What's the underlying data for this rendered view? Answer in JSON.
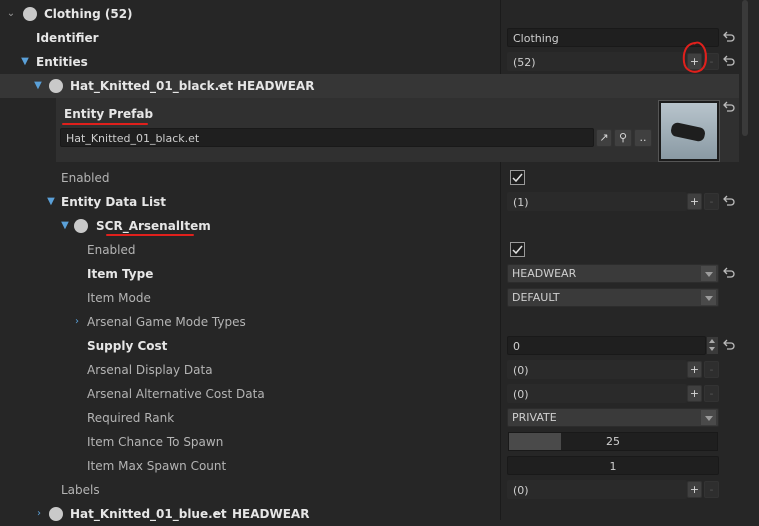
{
  "colors": {
    "accent_arrow": "#5aa0d8",
    "annotation": "#e0201c",
    "background": "#262626"
  },
  "header": {
    "title": "Clothing (52)"
  },
  "identifier": {
    "label": "Identifier",
    "value": "Clothing"
  },
  "entities": {
    "label": "Entities",
    "value": "(52)",
    "add": "+",
    "remove": "-"
  },
  "entity1": {
    "name": "Hat_Knitted_01_black.et",
    "sep": "~",
    "tag": "HEADWEAR"
  },
  "prefab": {
    "label": "Entity Prefab",
    "path": "Hat_Knitted_01_black.et",
    "browse": ".."
  },
  "enabled1": {
    "label": "Enabled"
  },
  "data_list": {
    "label": "Entity Data List",
    "value": "(1)",
    "add": "+",
    "remove": "-"
  },
  "arsenal": {
    "label": "SCR_ArsenalItem"
  },
  "props": {
    "enabled": "Enabled",
    "item_type": {
      "label": "Item Type",
      "value": "HEADWEAR"
    },
    "item_mode": {
      "label": "Item Mode",
      "value": "DEFAULT"
    },
    "game_modes": "Arsenal Game Mode Types",
    "supply_cost": {
      "label": "Supply Cost",
      "value": "0"
    },
    "display_data": {
      "label": "Arsenal Display Data",
      "value": "(0)",
      "add": "+",
      "remove": "-"
    },
    "alt_cost": {
      "label": "Arsenal Alternative Cost Data",
      "value": "(0)",
      "add": "+",
      "remove": "-"
    },
    "rank": {
      "label": "Required Rank",
      "value": "PRIVATE"
    },
    "chance": {
      "label": "Item Chance To Spawn",
      "value": "25",
      "fraction": 0.25
    },
    "max_spawn": {
      "label": "Item Max Spawn Count",
      "value": "1"
    }
  },
  "labels": {
    "label": "Labels",
    "value": "(0)",
    "add": "+",
    "remove": "-"
  },
  "entity2": {
    "name": "Hat_Knitted_01_blue.et",
    "sep": "~",
    "tag": "HEADWEAR"
  }
}
